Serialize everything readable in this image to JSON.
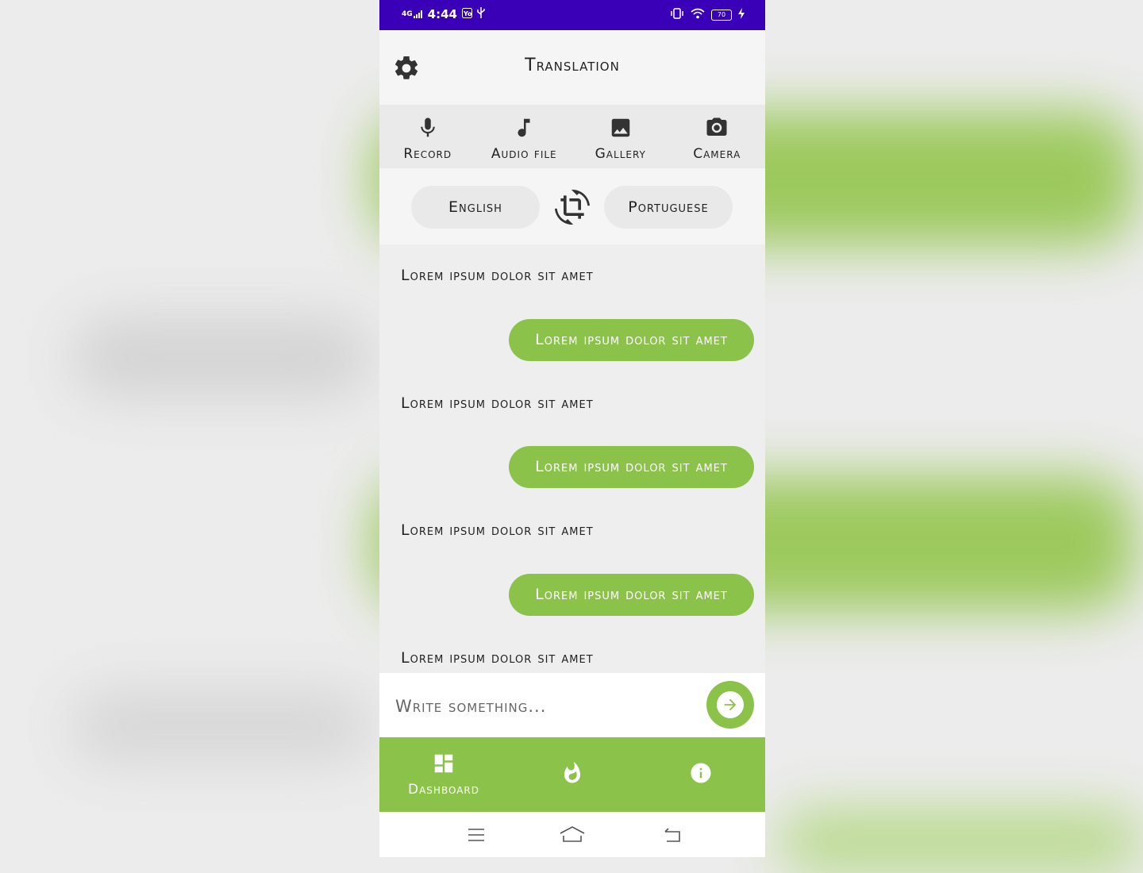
{
  "statusbar": {
    "network": "4G",
    "time": "4:44",
    "battery": "70"
  },
  "appbar": {
    "title": "Translation",
    "settings_icon": "gear-icon"
  },
  "tools": [
    {
      "label": "Record",
      "icon": "microphone-icon"
    },
    {
      "label": "Audio file",
      "icon": "music-note-icon"
    },
    {
      "label": "Gallery",
      "icon": "image-icon"
    },
    {
      "label": "Camera",
      "icon": "camera-icon"
    }
  ],
  "languages": {
    "source": "English",
    "target": "Portuguese",
    "swap_icon": "swap-rotate-icon"
  },
  "messages": [
    {
      "source": "Lorem ipsum dolor sit amet",
      "translation": "Lorem ipsum dolor sit amet"
    },
    {
      "source": "Lorem ipsum dolor sit amet",
      "translation": "Lorem ipsum dolor sit amet"
    },
    {
      "source": "Lorem ipsum dolor sit amet",
      "translation": "Lorem ipsum dolor sit amet"
    },
    {
      "source": "Lorem ipsum dolor sit amet"
    }
  ],
  "composer": {
    "placeholder": "Write something...",
    "value": "",
    "send_icon": "arrow-right-icon"
  },
  "bottom_nav": [
    {
      "label": "Dashboard",
      "icon": "dashboard-icon",
      "active": true
    },
    {
      "label": "",
      "icon": "flame-icon"
    },
    {
      "label": "",
      "icon": "info-icon"
    }
  ],
  "colors": {
    "status_bar": "#3a00b8",
    "accent": "#8bc34a",
    "text": "#222222"
  }
}
